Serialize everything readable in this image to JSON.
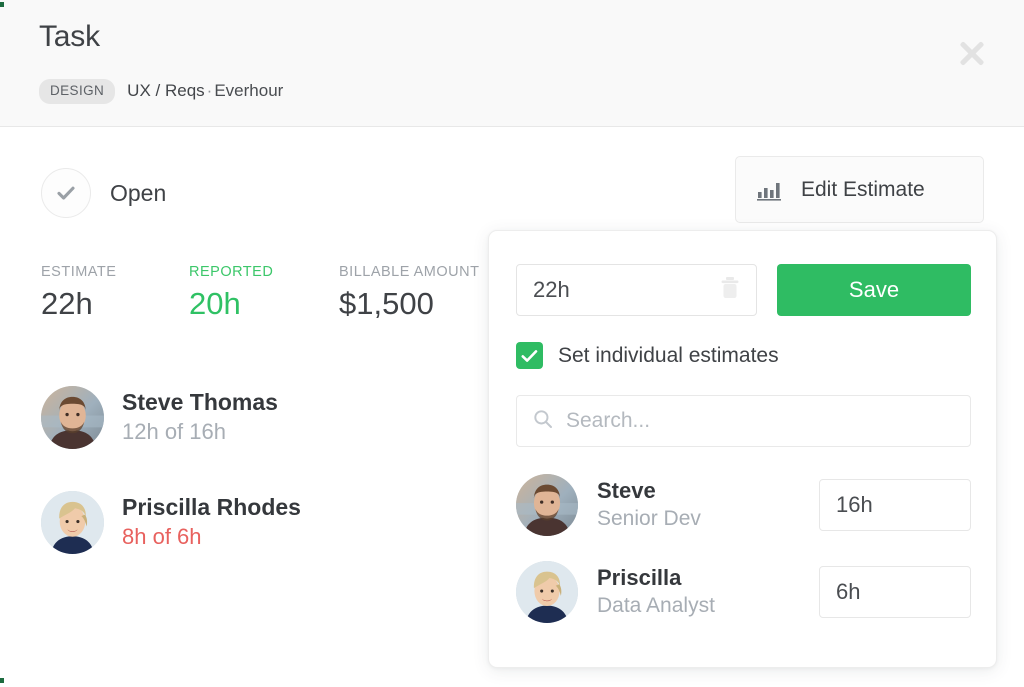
{
  "header": {
    "title": "Task",
    "badge": "DESIGN",
    "breadcrumb_path": "UX / Reqs",
    "breadcrumb_separator": "·",
    "breadcrumb_project": "Everhour",
    "close_icon": "close-icon"
  },
  "status": {
    "icon": "check-circle-icon",
    "label": "Open"
  },
  "metrics": [
    {
      "label": "ESTIMATE",
      "value": "22h",
      "color": "#3f4246"
    },
    {
      "label": "REPORTED",
      "value": "20h",
      "color": "#2fc164"
    },
    {
      "label": "BILLABLE AMOUNT",
      "value": "$1,500",
      "color": "#3f4246"
    }
  ],
  "assignees": [
    {
      "name": "Steve Thomas",
      "progress": "12h of 16h",
      "over": false
    },
    {
      "name": "Priscilla Rhodes",
      "progress": "8h of 6h",
      "over": true
    }
  ],
  "edit_estimate_button": {
    "label": "Edit Estimate",
    "icon": "bar-chart-icon"
  },
  "popup": {
    "estimate_input": {
      "value": "22h",
      "trash_icon": "trash-icon"
    },
    "save_label": "Save",
    "checkbox": {
      "label": "Set individual estimates",
      "checked": true
    },
    "search": {
      "placeholder": "Search...",
      "icon": "search-icon",
      "value": ""
    },
    "people": [
      {
        "name": "Steve",
        "role": "Senior Dev",
        "estimate": "16h"
      },
      {
        "name": "Priscilla",
        "role": "Data Analyst",
        "estimate": "6h"
      }
    ]
  },
  "colors": {
    "green": "#2fbc63",
    "red": "#e8615e",
    "muted": "#a7adb4",
    "header_bg": "#f9f9f9"
  }
}
